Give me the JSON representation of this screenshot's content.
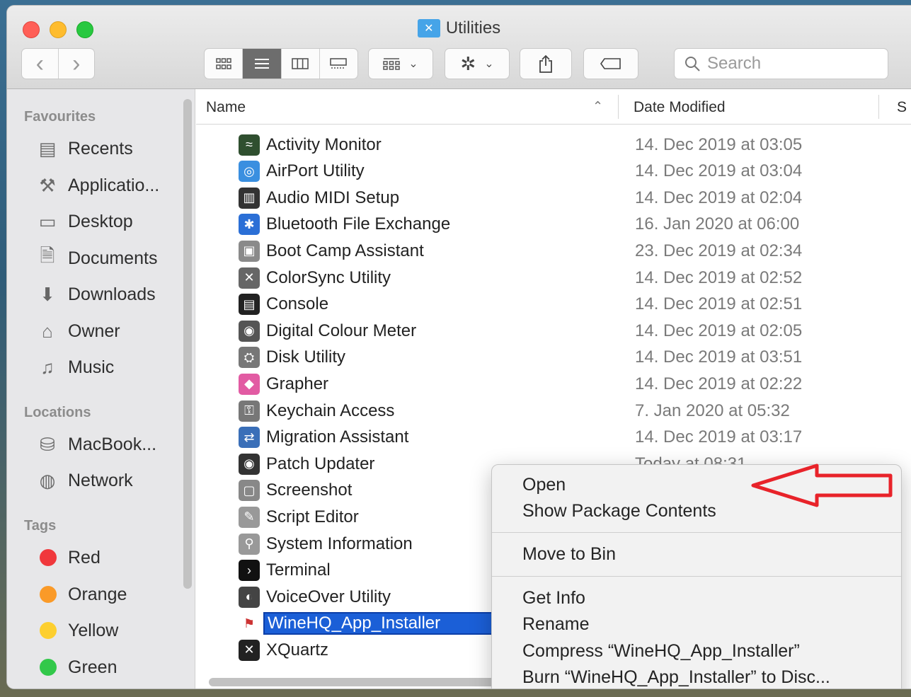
{
  "window": {
    "title": "Utilities"
  },
  "toolbar": {
    "back": "‹",
    "forward": "›",
    "search_placeholder": "Search"
  },
  "sidebar": {
    "favourites_heading": "Favourites",
    "favourites": [
      {
        "label": "Recents",
        "icon": "recents-icon"
      },
      {
        "label": "Applicatio...",
        "icon": "applications-icon"
      },
      {
        "label": "Desktop",
        "icon": "desktop-icon"
      },
      {
        "label": "Documents",
        "icon": "documents-icon"
      },
      {
        "label": "Downloads",
        "icon": "downloads-icon"
      },
      {
        "label": "Owner",
        "icon": "home-icon"
      },
      {
        "label": "Music",
        "icon": "music-icon"
      }
    ],
    "locations_heading": "Locations",
    "locations": [
      {
        "label": "MacBook...",
        "icon": "disk-icon"
      },
      {
        "label": "Network",
        "icon": "network-icon"
      }
    ],
    "tags_heading": "Tags",
    "tags": [
      {
        "label": "Red",
        "color": "#f0383c"
      },
      {
        "label": "Orange",
        "color": "#fa9a28"
      },
      {
        "label": "Yellow",
        "color": "#fdcf2f"
      },
      {
        "label": "Green",
        "color": "#32c84a"
      }
    ]
  },
  "columns": {
    "name": "Name",
    "date": "Date Modified",
    "size": "S"
  },
  "files": [
    {
      "name": "Activity Monitor",
      "date": "14. Dec 2019 at 03:05"
    },
    {
      "name": "AirPort Utility",
      "date": "14. Dec 2019 at 03:04"
    },
    {
      "name": "Audio MIDI Setup",
      "date": "14. Dec 2019 at 02:04"
    },
    {
      "name": "Bluetooth File Exchange",
      "date": "16. Jan 2020 at 06:00"
    },
    {
      "name": "Boot Camp Assistant",
      "date": "23. Dec 2019 at 02:34"
    },
    {
      "name": "ColorSync Utility",
      "date": "14. Dec 2019 at 02:52"
    },
    {
      "name": "Console",
      "date": "14. Dec 2019 at 02:51"
    },
    {
      "name": "Digital Colour Meter",
      "date": "14. Dec 2019 at 02:05"
    },
    {
      "name": "Disk Utility",
      "date": "14. Dec 2019 at 03:51"
    },
    {
      "name": "Grapher",
      "date": "14. Dec 2019 at 02:22"
    },
    {
      "name": "Keychain Access",
      "date": "7. Jan 2020 at 05:32"
    },
    {
      "name": "Migration Assistant",
      "date": "14. Dec 2019 at 03:17"
    },
    {
      "name": "Patch Updater",
      "date": "Today at 08:31"
    },
    {
      "name": "Screenshot",
      "date": ""
    },
    {
      "name": "Script Editor",
      "date": ""
    },
    {
      "name": "System Information",
      "date": ""
    },
    {
      "name": "Terminal",
      "date": ""
    },
    {
      "name": "VoiceOver Utility",
      "date": ""
    },
    {
      "name": "WineHQ_App_Installer",
      "date": ""
    },
    {
      "name": "XQuartz",
      "date": ""
    }
  ],
  "context_menu": {
    "open": "Open",
    "show_package": "Show Package Contents",
    "move_to_bin": "Move to Bin",
    "get_info": "Get Info",
    "rename": "Rename",
    "compress": "Compress “WineHQ_App_Installer”",
    "burn": "Burn “WineHQ_App_Installer” to Disc..."
  },
  "colors": {
    "selection": "#1b5fd7",
    "annotation_arrow": "#e8232a"
  }
}
